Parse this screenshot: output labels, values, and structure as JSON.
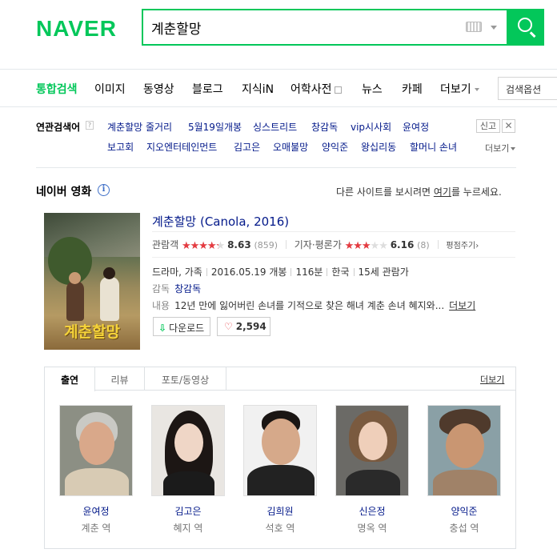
{
  "header": {
    "logo": "NAVER",
    "query": "계춘할망"
  },
  "tabs": [
    {
      "label": "통합검색",
      "active": true
    },
    {
      "label": "이미지"
    },
    {
      "label": "동영상"
    },
    {
      "label": "블로그"
    },
    {
      "label": "지식iN"
    },
    {
      "label": "어학사전"
    },
    {
      "label": "뉴스"
    },
    {
      "label": "카페"
    },
    {
      "label": "더보기"
    }
  ],
  "search_option": "검색옵션",
  "related": {
    "title": "연관검색어",
    "help": "?",
    "row1": [
      "계춘할망 줄거리",
      "5월19일개봉",
      "싱스트리트",
      "창감독",
      "vip시사회",
      "윤여정"
    ],
    "row2": [
      "보고회",
      "지오엔터테인먼트",
      "김고은",
      "오매불망",
      "양익준",
      "왕십리동",
      "할머니 손녀"
    ],
    "report": "신고",
    "close": "✕",
    "more": "더보기"
  },
  "movie_section": {
    "title": "네이버 영화",
    "info": "i",
    "other_site_pre": "다른 사이트를 보시려면 ",
    "other_site_link": "여기",
    "other_site_post": "를 누르세요."
  },
  "movie": {
    "poster_title": "계춘할망",
    "title": "계춘할망 (Canola, 2016)",
    "audience_label": "관람객",
    "audience_score": "8.63",
    "audience_count": "(859)",
    "audience_fraction": 0.863,
    "critic_label": "기자·평론가",
    "critic_score": "6.16",
    "critic_count": "(8)",
    "critic_fraction": 0.616,
    "rate_link": "평점주기",
    "genre": "드라마, 가족",
    "release": "2016.05.19 개봉",
    "runtime": "116분",
    "country": "한국",
    "age": "15세 관람가",
    "director_label": "감독",
    "director": "창감독",
    "plot_label": "내용",
    "plot": "12년 만에 잃어버린 손녀를 기적으로 찾은 해녀 계춘 손녀 혜지와...",
    "plot_more": "더보기",
    "download": "다운로드",
    "likes": "2,594"
  },
  "cast": {
    "tabs": [
      "출연",
      "리뷰",
      "포토/동영상"
    ],
    "more": "더보기",
    "people": [
      {
        "name": "윤여정",
        "role": "계춘 역"
      },
      {
        "name": "김고은",
        "role": "혜지 역"
      },
      {
        "name": "김희원",
        "role": "석호 역"
      },
      {
        "name": "신은정",
        "role": "명옥 역"
      },
      {
        "name": "양익준",
        "role": "충섭 역"
      }
    ]
  },
  "colors": {
    "brand": "#03c75a",
    "link": "#03198a",
    "star": "#e53a40"
  }
}
